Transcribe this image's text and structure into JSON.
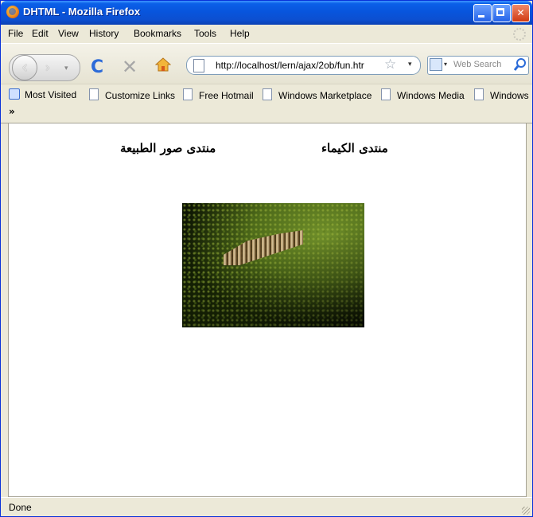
{
  "window": {
    "title": "DHTML - Mozilla Firefox",
    "icon": "firefox-icon",
    "controls": [
      "minimize-icon",
      "maximize-icon",
      "close-icon"
    ]
  },
  "menu": {
    "items": [
      "File",
      "Edit",
      "View",
      "History",
      "Bookmarks",
      "Tools",
      "Help"
    ]
  },
  "toolbar": {
    "back_icon": "‹",
    "forward_icon": "›",
    "dropdown_glyph": "▾",
    "reload_icon": "C",
    "stop_icon": "✕",
    "url": "http://localhost/lern/ajax/2ob/fun.htr",
    "bookmark_star": "☆",
    "search_placeholder": "Web Search"
  },
  "bookmarks": {
    "items": [
      "Most Visited",
      "Customize Links",
      "Free Hotmail",
      "Windows Marketplace",
      "Windows Media",
      "Windows"
    ],
    "overflow": "»"
  },
  "content": {
    "links": [
      "منتدى صور الطبيعة",
      "منتدى الكيماء"
    ],
    "image": "forest-photo"
  },
  "status": {
    "text": "Done"
  },
  "colors": {
    "titlebar": "#0855dd",
    "chrome": "#ece9d8",
    "reload_blue": "#2d6bd8"
  }
}
